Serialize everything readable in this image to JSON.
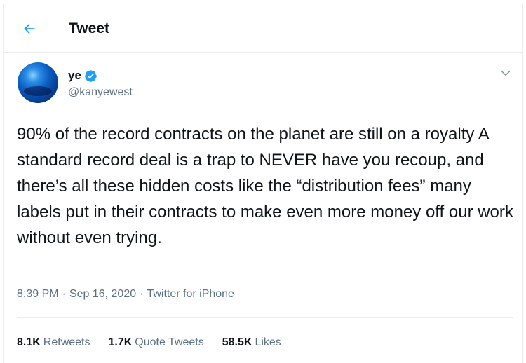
{
  "header": {
    "back_icon": "arrow-left-icon",
    "title": "Tweet"
  },
  "tweet": {
    "author_name": "ye",
    "verified_icon": "verified-badge-icon",
    "handle": "@kanyewest",
    "more_icon": "chevron-down-icon",
    "text": "90% of the record contracts on the planet are still on a royalty A standard record deal is a trap to NEVER have you recoup, and there’s all these hidden costs like the “distribution fees” many labels put in their contracts to make even more money off our work without even trying.",
    "time": "8:39 PM",
    "date": "Sep 16, 2020",
    "source": "Twitter for iPhone",
    "separator": "·"
  },
  "stats": {
    "retweets_count": "8.1K",
    "retweets_label": "Retweets",
    "quotes_count": "1.7K",
    "quotes_label": "Quote Tweets",
    "likes_count": "58.5K",
    "likes_label": "Likes"
  },
  "colors": {
    "accent": "#1da1f2",
    "secondary_text": "#5b7083",
    "divider": "#e6ecf0"
  }
}
